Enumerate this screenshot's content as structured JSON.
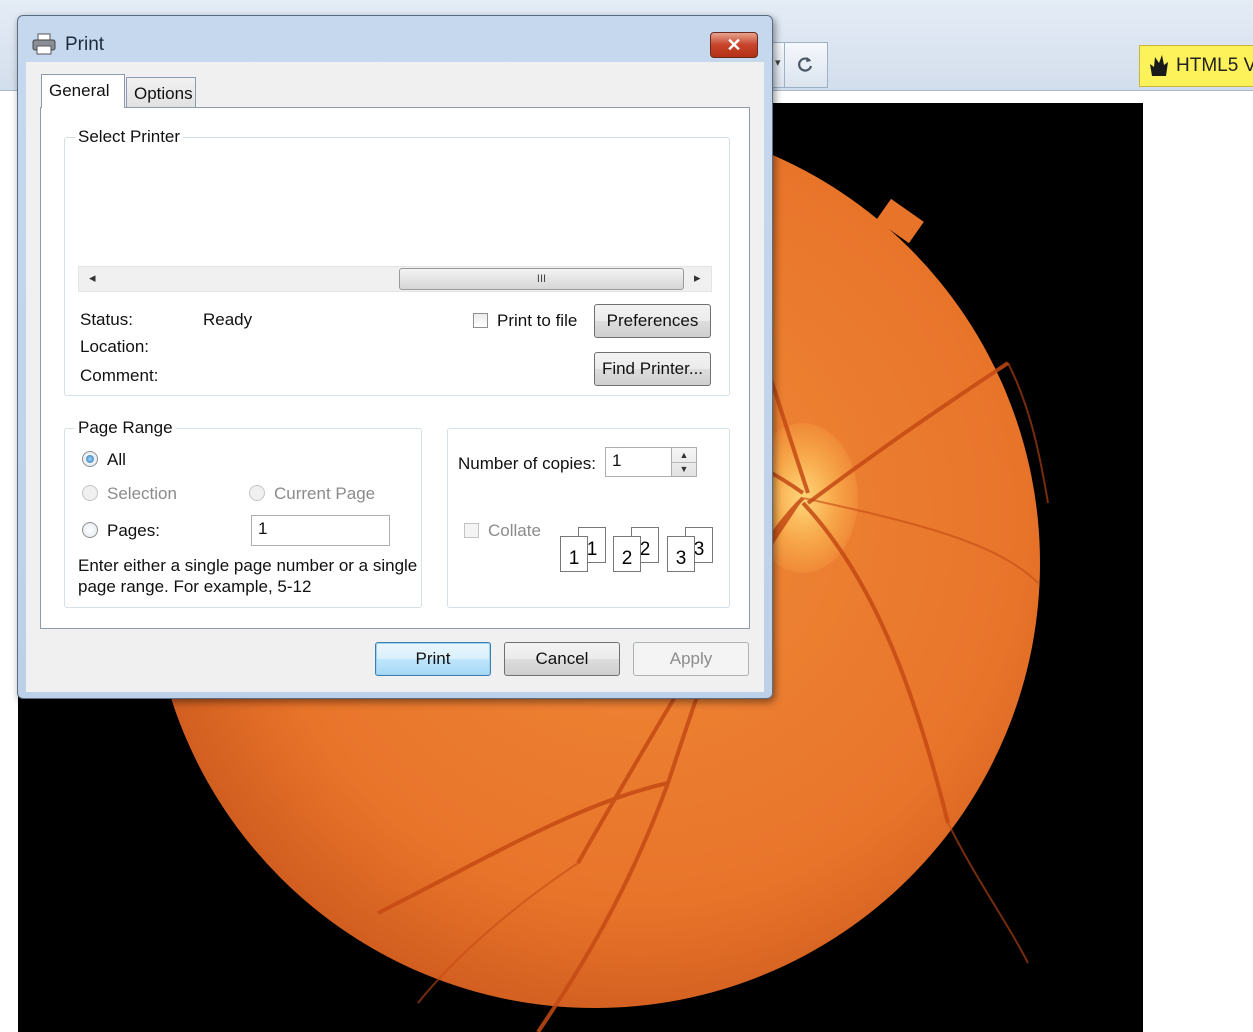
{
  "browser": {
    "html5_button_label": "HTML5 V",
    "refresh_icon": "refresh-icon",
    "dropdown_icon": "dropdown-arrow-icon"
  },
  "dialog": {
    "title": "Print",
    "close_symbol": "✕",
    "tabs": [
      {
        "label": "General",
        "active": true
      },
      {
        "label": "Options",
        "active": false
      }
    ],
    "select_printer": {
      "group_label": "Select Printer",
      "scroll_left": "◂",
      "scroll_right": "▸",
      "scroll_grip": "III",
      "status_label": "Status:",
      "status_value": "Ready",
      "location_label": "Location:",
      "comment_label": "Comment:",
      "print_to_file_label": "Print to file",
      "print_to_file_checked": false,
      "preferences_label": "Preferences",
      "find_printer_label": "Find Printer..."
    },
    "page_range": {
      "group_label": "Page Range",
      "all_label": "All",
      "selection_label": "Selection",
      "current_page_label": "Current Page",
      "pages_label": "Pages:",
      "pages_value": "1",
      "selected_option": "All",
      "help_line1": "Enter either a single page number or a single",
      "help_line2": "page range.  For example, 5-12"
    },
    "copies": {
      "number_label": "Number of copies:",
      "number_value": "1",
      "spin_up": "▲",
      "spin_down": "▼",
      "collate_label": "Collate",
      "collate_checked": false,
      "collate_pages": [
        {
          "back": "1",
          "front": "1"
        },
        {
          "back": "2",
          "front": "2"
        },
        {
          "back": "3",
          "front": "3"
        }
      ]
    },
    "buttons": {
      "print_label": "Print",
      "cancel_label": "Cancel",
      "apply_label": "Apply"
    }
  },
  "colors": {
    "fundus_orange": "#e8742a",
    "vessel_red": "#c44a14",
    "background_black": "#000000",
    "html5_yellow": "#fdf25a",
    "titlebar_blue": "#c6d8ee"
  }
}
